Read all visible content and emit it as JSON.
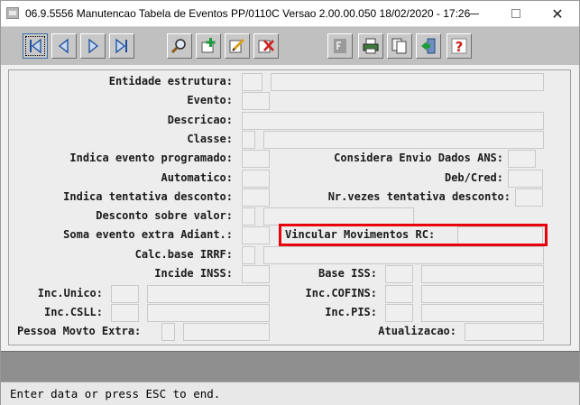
{
  "window": {
    "title": "06.9.5556 Manutencao  Tabela de Eventos PP/0110C Versao 2.00.00.050 18/02/2020 - 17:26",
    "close_glyph": "✕"
  },
  "toolbar": {
    "nav": [
      "first-record-icon",
      "previous-record-icon",
      "next-record-icon",
      "last-record-icon"
    ],
    "edit": [
      "search-icon",
      "add-icon",
      "edit-icon",
      "delete-icon"
    ],
    "misc": [
      "filter-icon",
      "print-icon",
      "copy-icon",
      "exit-icon",
      "help-icon"
    ]
  },
  "form": {
    "entidade_estrutura": "Entidade estrutura:",
    "evento": "Evento:",
    "descricao": "Descricao:",
    "classe": "Classe:",
    "indica_evento_programado": "Indica evento programado:",
    "considera_envio_dados_ans": "Considera Envio Dados ANS:",
    "automatico": "Automatico:",
    "deb_cred": "Deb/Cred:",
    "indica_tentativa_desconto": "Indica tentativa desconto:",
    "nr_vezes_tentativa_desconto": "Nr.vezes tentativa desconto:",
    "desconto_sobre_valor": "Desconto sobre valor:",
    "soma_evento_extra_adiant": "Soma evento extra Adiant.:",
    "vincular_movimentos_rc": "Vincular Movimentos RC:",
    "calc_base_irrf": "Calc.base IRRF:",
    "incide_inss": "Incide INSS:",
    "base_iss": "Base ISS:",
    "inc_unico": "Inc.Unico:",
    "inc_cofins": "Inc.COFINS:",
    "inc_csll": "Inc.CSLL:",
    "inc_pis": "Inc.PIS:",
    "pessoa_movto_extra": "Pessoa Movto Extra:",
    "atualizacao": "Atualizacao:"
  },
  "status": {
    "message": "Enter data or press ESC to end."
  },
  "colors": {
    "highlight": "#e8000a",
    "toolbar": "#c0c0c0",
    "status_panel": "#8f8f8f"
  }
}
